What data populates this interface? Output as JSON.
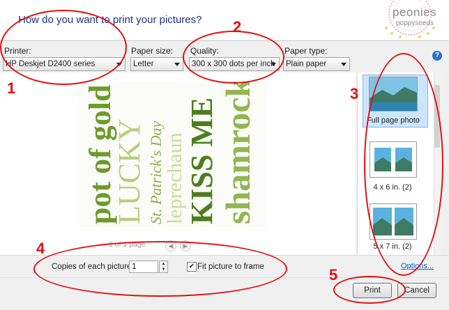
{
  "dialog": {
    "title": "How do you want to print your pictures?",
    "help_glyph": "?"
  },
  "logo": {
    "line1": "peonies",
    "line2": "poppyseeds"
  },
  "fields": {
    "printer": {
      "label": "Printer:",
      "value": "HP Deskjet D2400 series"
    },
    "paper_size": {
      "label": "Paper size:",
      "value": "Letter"
    },
    "quality": {
      "label": "Quality:",
      "value": "300 x 300 dots per inch"
    },
    "paper_type": {
      "label": "Paper type:",
      "value": "Plain paper"
    }
  },
  "preview": {
    "page_counter": "1 of 1 page",
    "words": [
      "pot of gold",
      "LUCKY",
      "St. Patrick's Day",
      "leprechaun",
      "KISS ME",
      "shamrocks"
    ]
  },
  "layouts": [
    {
      "label": "Full page photo",
      "selected": true
    },
    {
      "label": "4 x 6 in. (2)",
      "selected": false
    },
    {
      "label": "5 x 7 in. (2)",
      "selected": false
    }
  ],
  "options_bar": {
    "copies_label": "Copies of each picture:",
    "copies_value": "1",
    "fit_label": "Fit picture to frame",
    "fit_checked": true,
    "options_link": "Options..."
  },
  "buttons": {
    "print": "Print",
    "cancel": "Cancel"
  },
  "annotations": [
    "1",
    "2",
    "3",
    "4",
    "5"
  ],
  "colors": {
    "annotation": "#e41010",
    "title": "#1e3287",
    "link": "#0066cc",
    "green": "#6f9a2e"
  }
}
